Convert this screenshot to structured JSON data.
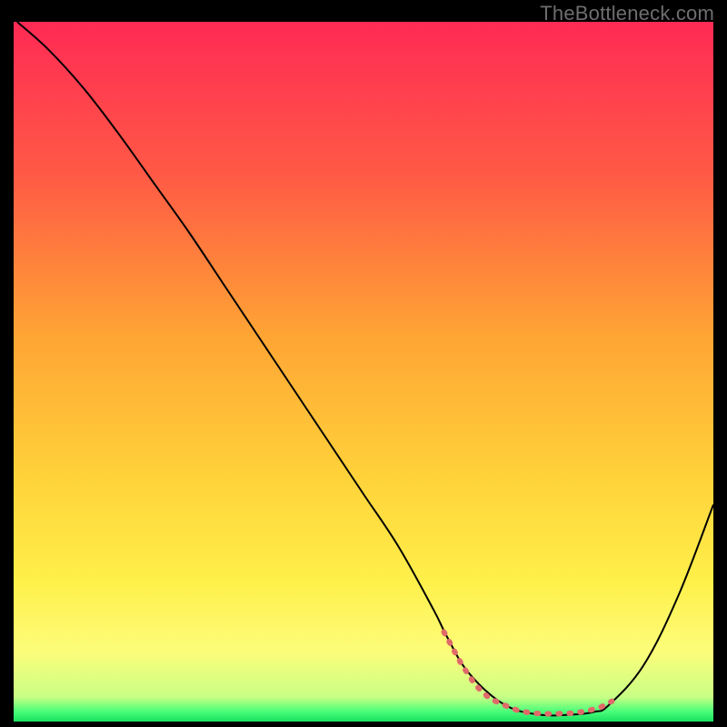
{
  "attribution": "TheBottleneck.com",
  "chart_data": {
    "type": "line",
    "title": "",
    "xlabel": "",
    "ylabel": "",
    "xlim": [
      0,
      100
    ],
    "ylim": [
      0,
      100
    ],
    "background_gradient": {
      "orientation": "vertical",
      "stops": [
        {
          "offset": 0.0,
          "color": "#ff2a55"
        },
        {
          "offset": 0.22,
          "color": "#ff5a45"
        },
        {
          "offset": 0.45,
          "color": "#ffa534"
        },
        {
          "offset": 0.65,
          "color": "#ffd23a"
        },
        {
          "offset": 0.8,
          "color": "#fff04a"
        },
        {
          "offset": 0.9,
          "color": "#fdfd7a"
        },
        {
          "offset": 0.965,
          "color": "#c8ff85"
        },
        {
          "offset": 0.985,
          "color": "#4dff7a"
        },
        {
          "offset": 1.0,
          "color": "#18e05f"
        }
      ]
    },
    "series": [
      {
        "name": "bottleneck-curve",
        "color": "#000000",
        "stroke_width": 2,
        "x": [
          0.5,
          5,
          10,
          15,
          20,
          25,
          30,
          35,
          40,
          45,
          50,
          55,
          60,
          62,
          65,
          70,
          75,
          80,
          83,
          85,
          90,
          95,
          100
        ],
        "y": [
          100,
          96,
          90.5,
          84,
          77,
          70,
          62.5,
          55,
          47.5,
          40,
          32.5,
          25,
          16,
          12,
          7,
          2.5,
          1,
          1,
          1.4,
          2.3,
          8,
          18,
          31
        ]
      },
      {
        "name": "optimal-zone-marker",
        "color": "#e06a6a",
        "stroke_width": 6,
        "dash": [
          2,
          10
        ],
        "linecap": "round",
        "x": [
          61.5,
          64,
          66,
          68,
          70,
          72,
          74,
          76,
          77,
          80,
          82,
          84,
          85.5
        ],
        "y": [
          12.8,
          8.2,
          5.2,
          3.3,
          2.4,
          1.6,
          1.2,
          1.1,
          1.1,
          1.2,
          1.5,
          2.1,
          2.9
        ]
      }
    ]
  }
}
